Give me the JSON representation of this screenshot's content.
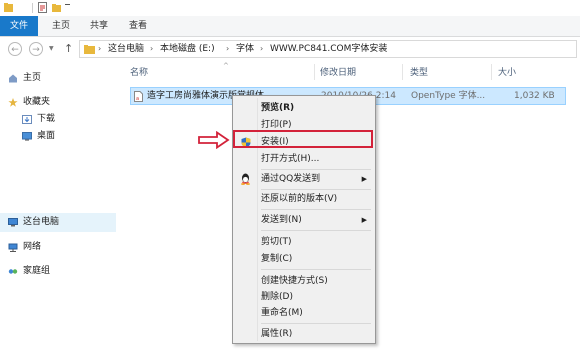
{
  "ribbon": {
    "file": "文件",
    "home": "主页",
    "share": "共享",
    "view": "查看"
  },
  "breadcrumb": [
    "这台电脑",
    "本地磁盘 (E:)",
    "字体",
    "WWW.PC841.COM字体安装"
  ],
  "sidebar": {
    "items": [
      {
        "label": "主页",
        "icon": "home-icon"
      },
      {
        "label": "收藏夹",
        "icon": "star-icon"
      },
      {
        "label": "下载",
        "icon": "download-icon"
      },
      {
        "label": "桌面",
        "icon": "desktop-icon"
      },
      {
        "label": "这台电脑",
        "icon": "computer-icon"
      },
      {
        "label": "网络",
        "icon": "network-icon"
      },
      {
        "label": "家庭组",
        "icon": "homegroup-icon"
      }
    ]
  },
  "columns": {
    "name": "名称",
    "date": "修改日期",
    "type": "类型",
    "size": "大小"
  },
  "file": {
    "name": "造字工房尚雅体演示版常规体",
    "date": "2010/10/26 2:14",
    "type": "OpenType 字体...",
    "size": "1,032 KB"
  },
  "context_menu": [
    {
      "label": "预览(R)",
      "bold": true
    },
    {
      "label": "打印(P)"
    },
    {
      "label": "安装(I)",
      "icon": "shield-icon"
    },
    {
      "label": "打开方式(H)..."
    },
    {
      "label": "通过QQ发送到",
      "icon": "qq-icon",
      "submenu": true
    },
    {
      "label": "还原以前的版本(V)"
    },
    {
      "label": "发送到(N)",
      "submenu": true
    },
    {
      "label": "剪切(T)"
    },
    {
      "label": "复制(C)"
    },
    {
      "label": "创建快捷方式(S)"
    },
    {
      "label": "删除(D)"
    },
    {
      "label": "重命名(M)"
    },
    {
      "label": "属性(R)"
    }
  ],
  "colors": {
    "accent": "#1979ca",
    "highlight_box": "#d3223a",
    "selection": "#cce8ff"
  }
}
